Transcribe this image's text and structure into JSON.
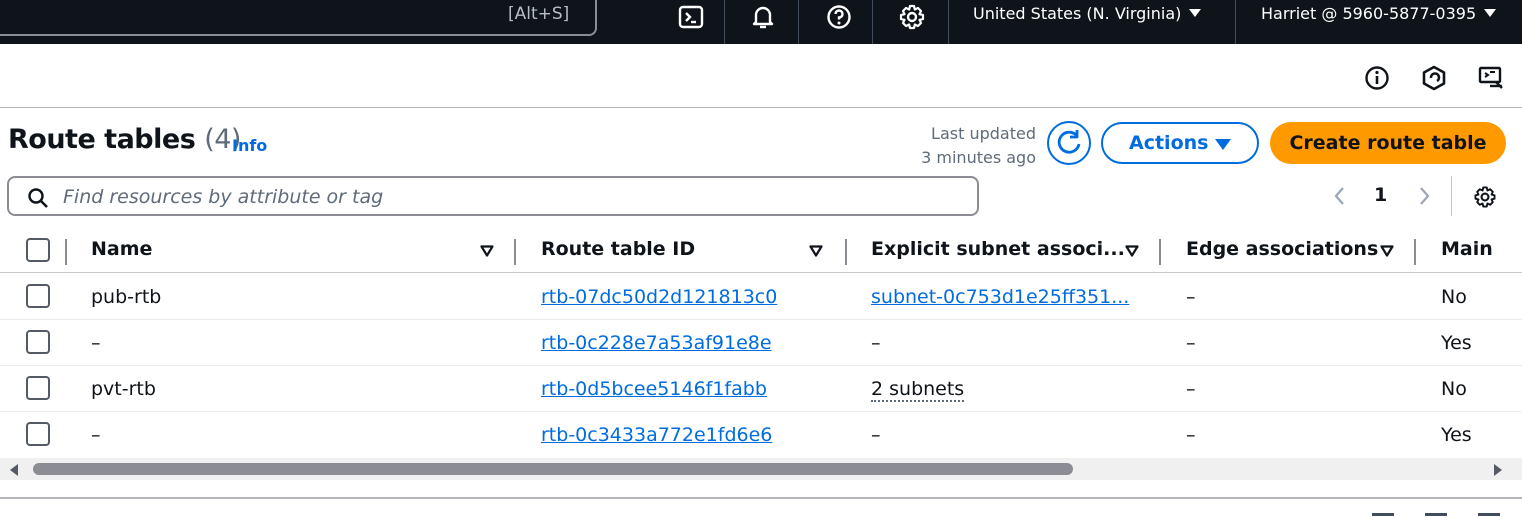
{
  "topnav": {
    "search_shortcut": "[Alt+S]",
    "region": "United States (N. Virginia)",
    "account": "Harriet @ 5960-5877-0395",
    "icons": [
      "cloudshell-icon",
      "bell-icon",
      "help-icon",
      "settings-icon"
    ]
  },
  "utility_icons": [
    "info-circle-icon",
    "aws-hexagon-icon",
    "feedback-screen-icon"
  ],
  "header": {
    "title": "Route tables",
    "count": "(4)",
    "info": "Info",
    "last_updated_line1": "Last updated",
    "last_updated_line2": "3 minutes ago",
    "actions": "Actions",
    "create": "Create route table"
  },
  "filter": {
    "placeholder": "Find resources by attribute or tag"
  },
  "pagination": {
    "current_page": "1"
  },
  "table": {
    "columns": [
      "Name",
      "Route table ID",
      "Explicit subnet associ...",
      "Edge associations",
      "Main"
    ],
    "rows": [
      {
        "name": "pub-rtb",
        "id": "rtb-07dc50d2d121813c0",
        "subnet": "subnet-0c753d1e25ff351...",
        "edge": "–",
        "main": "No"
      },
      {
        "name": "–",
        "id": "rtb-0c228e7a53af91e8e",
        "subnet": "–",
        "edge": "–",
        "main": "Yes"
      },
      {
        "name": "pvt-rtb",
        "id": "rtb-0d5bcee5146f1fabb",
        "subnet": "2 subnets",
        "edge": "–",
        "main": "No"
      },
      {
        "name": "–",
        "id": "rtb-0c3433a772e1fd6e6",
        "subnet": "–",
        "edge": "–",
        "main": "Yes"
      }
    ]
  },
  "colors": {
    "nav_bg": "#0f141a",
    "link": "#006ce0",
    "primary_button": "#ff9900"
  }
}
